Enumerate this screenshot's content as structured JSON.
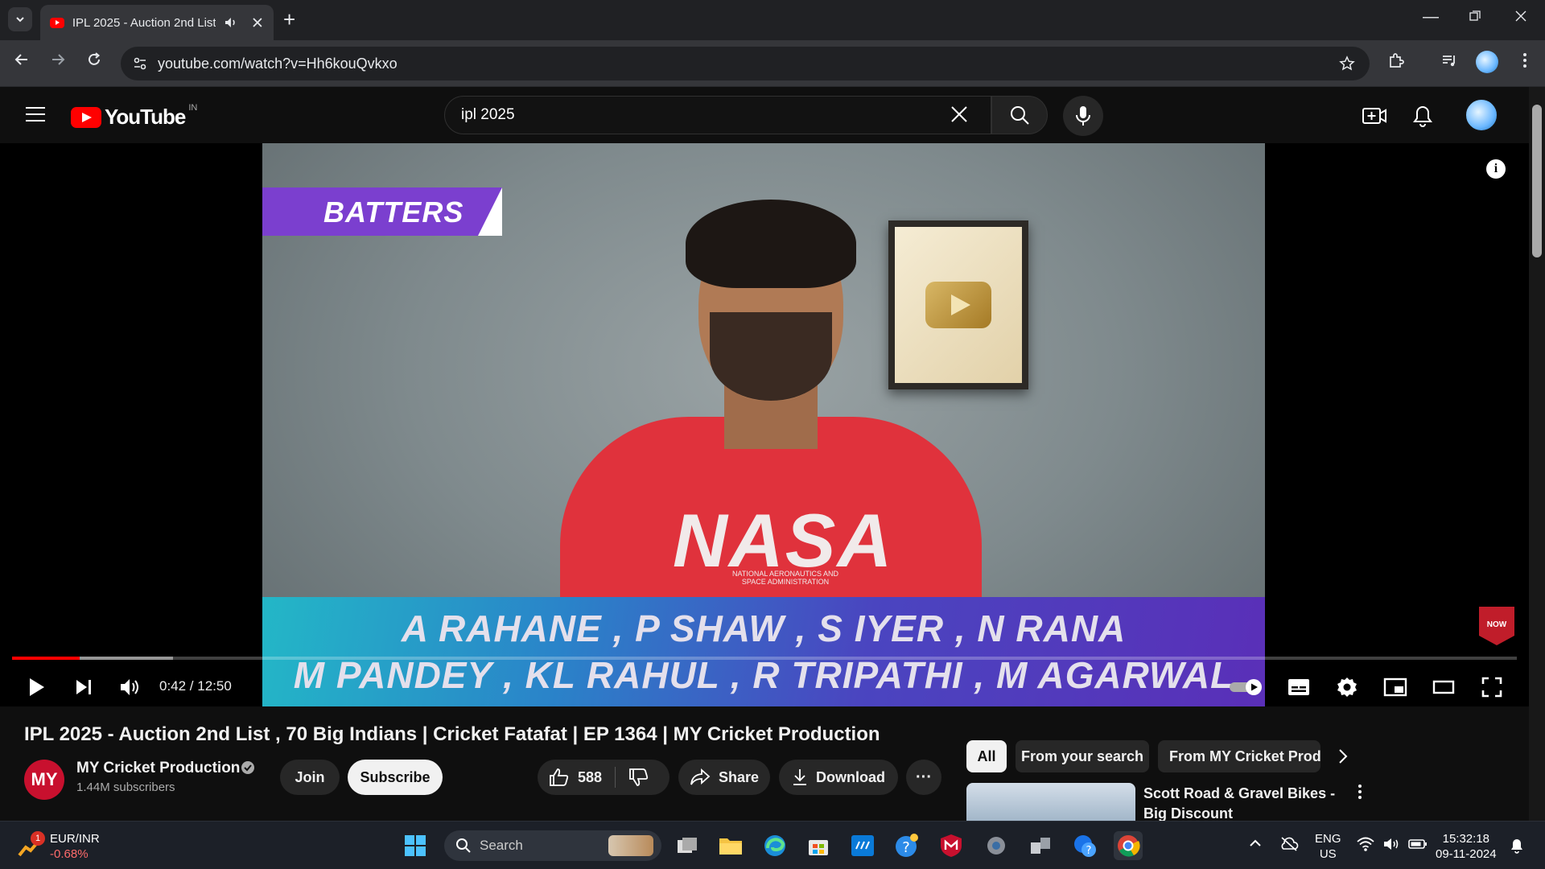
{
  "browser": {
    "tab_title": "IPL 2025 - Auction 2nd List",
    "url": "youtube.com/watch?v=Hh6kouQvkxo",
    "new_tab_label": "+"
  },
  "youtube": {
    "logo_text": "YouTube",
    "country_code": "IN",
    "search_value": "ipl 2025"
  },
  "video": {
    "overlay_label": "BATTERS",
    "names_line1": "A RAHANE , P SHAW , S IYER , N RANA",
    "names_line2": "M PANDEY , KL RAHUL , R TRIPATHI , M AGARWAL",
    "shirt_text": "NASA",
    "shirt_subtext": "NATIONAL AERONAUTICS AND SPACE ADMINISTRATION",
    "watermark_text": "NOW",
    "time_current": "0:42",
    "time_total": "12:50",
    "time_display": "0:42 / 12:50",
    "progress_played": 0.045,
    "progress_buffered": 0.107
  },
  "meta": {
    "title": "IPL 2025 - Auction 2nd List , 70 Big Indians | Cricket Fatafat | EP 1364 | MY Cricket Production",
    "channel_initials": "MY",
    "channel_name": "MY Cricket Production",
    "subscribers": "1.44M subscribers",
    "join_label": "Join",
    "subscribe_label": "Subscribe",
    "likes": "588",
    "share_label": "Share",
    "download_label": "Download",
    "more_label": "···"
  },
  "chips": [
    "All",
    "From your search",
    "From MY Cricket Production"
  ],
  "recommendation": {
    "title": "Scott Road & Gravel Bikes -Big Discount"
  },
  "taskbar": {
    "ticker_name": "EUR/INR",
    "ticker_change": "-0.68%",
    "ticker_badge": "1",
    "search_label": "Search",
    "lang_line1": "ENG",
    "lang_line2": "US",
    "time": "15:32:18",
    "date": "09-11-2024"
  },
  "colors": {
    "yt_red": "#ff0000",
    "batters_purple": "#7b3fcf",
    "shirt_red": "#e0323c"
  }
}
